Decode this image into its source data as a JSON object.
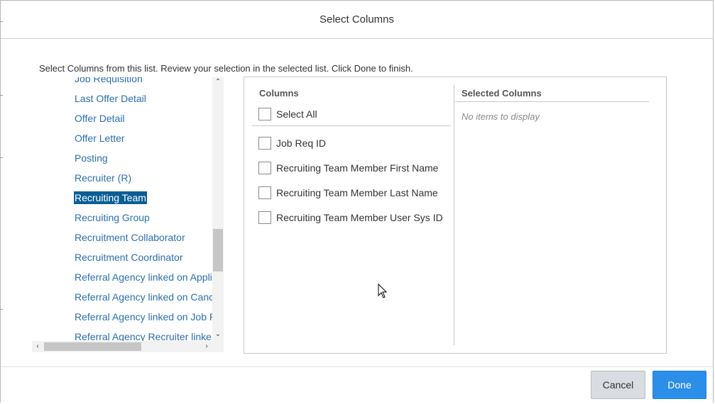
{
  "dialog": {
    "title": "Select Columns",
    "instructions": "Select Columns from this list. Review your selection in the selected list. Click Done to finish."
  },
  "tree": {
    "items": [
      {
        "label": "Job Requisition",
        "selected": false
      },
      {
        "label": "Last Offer Detail",
        "selected": false
      },
      {
        "label": "Offer Detail",
        "selected": false
      },
      {
        "label": "Offer Letter",
        "selected": false
      },
      {
        "label": "Posting",
        "selected": false
      },
      {
        "label": "Recruiter (R)",
        "selected": false
      },
      {
        "label": "Recruiting Team",
        "selected": true
      },
      {
        "label": "Recruiting Group",
        "selected": false
      },
      {
        "label": "Recruitment Collaborator",
        "selected": false
      },
      {
        "label": "Recruitment Coordinator",
        "selected": false
      },
      {
        "label": "Referral Agency linked on Appli",
        "selected": false
      },
      {
        "label": "Referral Agency linked on Canc",
        "selected": false
      },
      {
        "label": "Referral Agency linked on Job R",
        "selected": false
      },
      {
        "label": "Referral Agency Recruiter linke",
        "selected": false
      }
    ]
  },
  "columns": {
    "header": "Columns",
    "select_all": "Select All",
    "items": [
      {
        "label": "Job Req ID",
        "checked": false
      },
      {
        "label": "Recruiting Team Member First Name",
        "checked": false
      },
      {
        "label": "Recruiting Team Member Last Name",
        "checked": false
      },
      {
        "label": "Recruiting Team Member User Sys ID",
        "checked": false
      }
    ]
  },
  "selected_columns": {
    "header": "Selected Columns",
    "empty_text": "No items to display"
  },
  "footer": {
    "cancel_label": "Cancel",
    "done_label": "Done"
  },
  "colors": {
    "link": "#2a6fae",
    "selected_bg": "#0a5e95",
    "done_button": "#2b8ee8",
    "cancel_button": "#d9dde1"
  },
  "icons": {
    "scroll_up": "chevron-up-icon",
    "scroll_down": "chevron-down-icon",
    "scroll_left": "chevron-left-icon",
    "scroll_right": "chevron-right-icon",
    "mouse_cursor": "mouse-pointer-icon"
  }
}
